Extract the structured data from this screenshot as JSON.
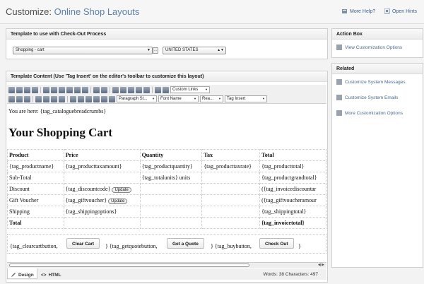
{
  "header": {
    "title_main": "Customize:",
    "title_sub": "Online Shop Layouts",
    "more_help": "More Help?",
    "open_hints": "Open Hints"
  },
  "template_panel": {
    "heading": "Template to use with Check-Out Process",
    "template_value": "Shopping - cart",
    "country_value": "UNITED STATES"
  },
  "content_panel": {
    "heading": "Template Content (Use 'Tag Insert' on the editor's toolbar to customize this layout)"
  },
  "toolbar": {
    "custom_links": "Custom Links",
    "paragraph": "Paragraph St...",
    "font_name": "Font Name",
    "size": "Rea...",
    "tag_insert": "Tag Insert"
  },
  "editor": {
    "breadcrumb": "You are here: {tag_cataloguebreadcrumbs}",
    "heading": "Your Shopping Cart",
    "table_headers": [
      "Product",
      "Price",
      "Quantity",
      "Tax",
      "Total"
    ],
    "rows": [
      [
        "{tag_productname}",
        "{tag_producttaxamount}",
        "{tag_productquantity}",
        "{tag_producttaxrate}",
        "{tag_producttotal}"
      ],
      [
        "Sub-Total",
        "",
        "{tag_totalunits} units",
        "",
        "{tag_productgrandtotal}"
      ],
      [
        "Discount",
        "{tag_discountcode}",
        "",
        "",
        "({tag_invoicediscountar"
      ],
      [
        "Gift Voucher",
        "{tag_giftvoucher}",
        "",
        "",
        "({tag_giftvoucheramour"
      ],
      [
        "Shipping",
        "{tag_shippingoptions}",
        "",
        "",
        "{tag_shippingtotal}"
      ],
      [
        "Total",
        "",
        "",
        "",
        "{tag_invoicetotal}"
      ]
    ],
    "update_label": "Update",
    "clear_text": "{tag_clearcartbutton,",
    "clear_btn": "Clear Cart",
    "quote_text": "} {tag_getquotebutton,",
    "quote_btn": "Get a Quote",
    "buy_text": "} {tag_buybutton,",
    "buy_btn": "Check Out",
    "close_brace": "}"
  },
  "footer": {
    "design_tab": "Design",
    "html_tab": "HTML",
    "counts": "Words: 38  Characters: 497"
  },
  "sidebar": {
    "action_box": {
      "heading": "Action Box",
      "items": [
        "View Customization Options"
      ]
    },
    "related": {
      "heading": "Related",
      "items": [
        "Customize System Messages",
        "Customize System Emails",
        "More Customization Options"
      ]
    }
  },
  "colors": {
    "link": "#3b5f8a",
    "title_sub": "#5b7fa6"
  }
}
